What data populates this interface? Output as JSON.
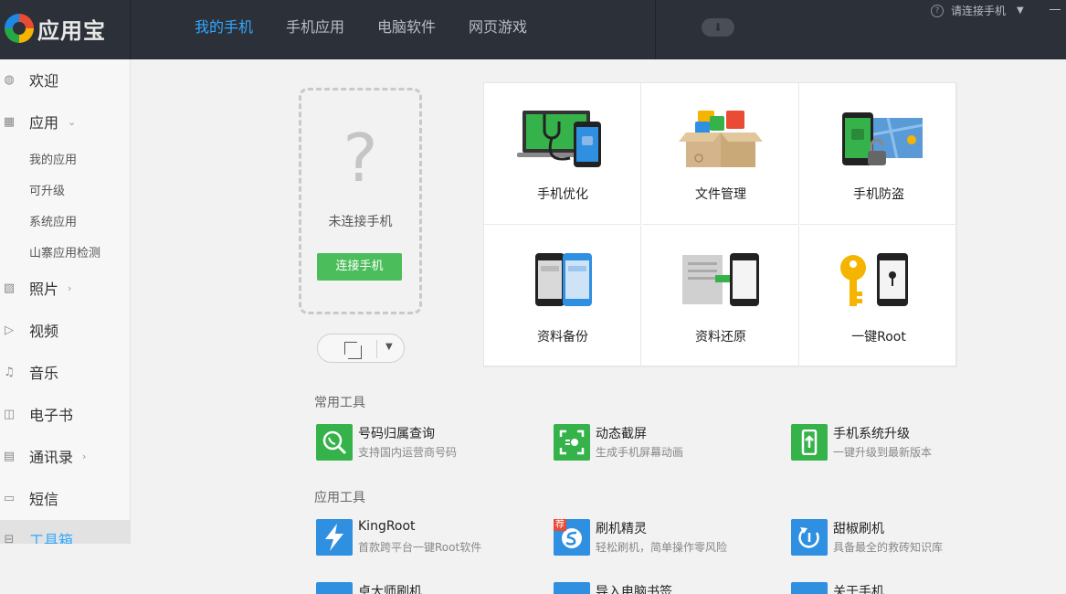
{
  "app": {
    "name": "应用宝"
  },
  "nav": {
    "tabs": [
      "我的手机",
      "手机应用",
      "电脑软件",
      "网页游戏"
    ],
    "active": 0,
    "connect_hint": "请连接手机"
  },
  "sidebar": {
    "items": [
      {
        "label": "欢迎",
        "icon": "globe-icon"
      },
      {
        "label": "应用",
        "icon": "grid-icon"
      },
      {
        "label": "照片",
        "icon": "image-icon"
      },
      {
        "label": "视频",
        "icon": "video-icon"
      },
      {
        "label": "音乐",
        "icon": "music-icon"
      },
      {
        "label": "电子书",
        "icon": "book-icon"
      },
      {
        "label": "通讯录",
        "icon": "contacts-icon"
      },
      {
        "label": "短信",
        "icon": "message-icon"
      },
      {
        "label": "工具箱",
        "icon": "toolbox-icon"
      }
    ],
    "sub_items": [
      "我的应用",
      "可升级",
      "系统应用",
      "山寨应用检测"
    ]
  },
  "device": {
    "status": "未连接手机",
    "connect_label": "连接手机"
  },
  "tiles": [
    {
      "label": "手机优化",
      "icon": "phone-optimize-icon"
    },
    {
      "label": "文件管理",
      "icon": "file-manager-icon"
    },
    {
      "label": "手机防盗",
      "icon": "anti-theft-icon"
    },
    {
      "label": "资料备份",
      "icon": "backup-icon"
    },
    {
      "label": "资料还原",
      "icon": "restore-icon"
    },
    {
      "label": "一键Root",
      "icon": "root-key-icon"
    }
  ],
  "common_tools": {
    "title": "常用工具",
    "items": [
      {
        "name": "号码归属查询",
        "desc": "支持国内运营商号码",
        "color": "#35b34a"
      },
      {
        "name": "动态截屏",
        "desc": "生成手机屏幕动画",
        "color": "#35b34a"
      },
      {
        "name": "手机系统升级",
        "desc": "一键升级到最新版本",
        "color": "#35b34a"
      }
    ]
  },
  "app_tools": {
    "title": "应用工具",
    "items": [
      {
        "name": "KingRoot",
        "desc": "首款跨平台一键Root软件",
        "color": "#2f8fe0"
      },
      {
        "name": "刷机精灵",
        "desc": "轻松刷机，简单操作零风险",
        "color": "#2f8fe0",
        "badge": "荐"
      },
      {
        "name": "甜椒刷机",
        "desc": "具备最全的救砖知识库",
        "color": "#2f8fe0"
      },
      {
        "name": "卓大师刷机",
        "desc": "",
        "color": "#2f8fe0"
      },
      {
        "name": "导入电脑书签",
        "desc": "",
        "color": "#2f8fe0"
      },
      {
        "name": "关于手机",
        "desc": "",
        "color": "#2f8fe0"
      }
    ]
  },
  "colors": {
    "accent": "#31a8ff",
    "green": "#4bbd5a",
    "topbar": "#2c3038"
  }
}
